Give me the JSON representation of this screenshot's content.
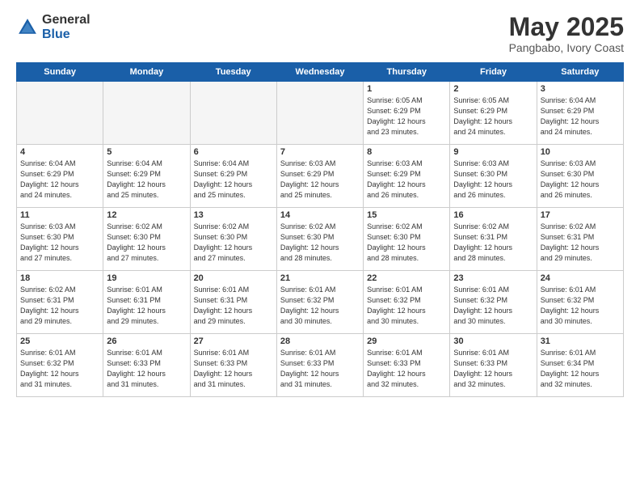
{
  "header": {
    "logo_general": "General",
    "logo_blue": "Blue",
    "title": "May 2025",
    "subtitle": "Pangbabo, Ivory Coast"
  },
  "weekdays": [
    "Sunday",
    "Monday",
    "Tuesday",
    "Wednesday",
    "Thursday",
    "Friday",
    "Saturday"
  ],
  "weeks": [
    [
      {
        "day": "",
        "info": ""
      },
      {
        "day": "",
        "info": ""
      },
      {
        "day": "",
        "info": ""
      },
      {
        "day": "",
        "info": ""
      },
      {
        "day": "1",
        "info": "Sunrise: 6:05 AM\nSunset: 6:29 PM\nDaylight: 12 hours\nand 23 minutes."
      },
      {
        "day": "2",
        "info": "Sunrise: 6:05 AM\nSunset: 6:29 PM\nDaylight: 12 hours\nand 24 minutes."
      },
      {
        "day": "3",
        "info": "Sunrise: 6:04 AM\nSunset: 6:29 PM\nDaylight: 12 hours\nand 24 minutes."
      }
    ],
    [
      {
        "day": "4",
        "info": "Sunrise: 6:04 AM\nSunset: 6:29 PM\nDaylight: 12 hours\nand 24 minutes."
      },
      {
        "day": "5",
        "info": "Sunrise: 6:04 AM\nSunset: 6:29 PM\nDaylight: 12 hours\nand 25 minutes."
      },
      {
        "day": "6",
        "info": "Sunrise: 6:04 AM\nSunset: 6:29 PM\nDaylight: 12 hours\nand 25 minutes."
      },
      {
        "day": "7",
        "info": "Sunrise: 6:03 AM\nSunset: 6:29 PM\nDaylight: 12 hours\nand 25 minutes."
      },
      {
        "day": "8",
        "info": "Sunrise: 6:03 AM\nSunset: 6:29 PM\nDaylight: 12 hours\nand 26 minutes."
      },
      {
        "day": "9",
        "info": "Sunrise: 6:03 AM\nSunset: 6:30 PM\nDaylight: 12 hours\nand 26 minutes."
      },
      {
        "day": "10",
        "info": "Sunrise: 6:03 AM\nSunset: 6:30 PM\nDaylight: 12 hours\nand 26 minutes."
      }
    ],
    [
      {
        "day": "11",
        "info": "Sunrise: 6:03 AM\nSunset: 6:30 PM\nDaylight: 12 hours\nand 27 minutes."
      },
      {
        "day": "12",
        "info": "Sunrise: 6:02 AM\nSunset: 6:30 PM\nDaylight: 12 hours\nand 27 minutes."
      },
      {
        "day": "13",
        "info": "Sunrise: 6:02 AM\nSunset: 6:30 PM\nDaylight: 12 hours\nand 27 minutes."
      },
      {
        "day": "14",
        "info": "Sunrise: 6:02 AM\nSunset: 6:30 PM\nDaylight: 12 hours\nand 28 minutes."
      },
      {
        "day": "15",
        "info": "Sunrise: 6:02 AM\nSunset: 6:30 PM\nDaylight: 12 hours\nand 28 minutes."
      },
      {
        "day": "16",
        "info": "Sunrise: 6:02 AM\nSunset: 6:31 PM\nDaylight: 12 hours\nand 28 minutes."
      },
      {
        "day": "17",
        "info": "Sunrise: 6:02 AM\nSunset: 6:31 PM\nDaylight: 12 hours\nand 29 minutes."
      }
    ],
    [
      {
        "day": "18",
        "info": "Sunrise: 6:02 AM\nSunset: 6:31 PM\nDaylight: 12 hours\nand 29 minutes."
      },
      {
        "day": "19",
        "info": "Sunrise: 6:01 AM\nSunset: 6:31 PM\nDaylight: 12 hours\nand 29 minutes."
      },
      {
        "day": "20",
        "info": "Sunrise: 6:01 AM\nSunset: 6:31 PM\nDaylight: 12 hours\nand 29 minutes."
      },
      {
        "day": "21",
        "info": "Sunrise: 6:01 AM\nSunset: 6:32 PM\nDaylight: 12 hours\nand 30 minutes."
      },
      {
        "day": "22",
        "info": "Sunrise: 6:01 AM\nSunset: 6:32 PM\nDaylight: 12 hours\nand 30 minutes."
      },
      {
        "day": "23",
        "info": "Sunrise: 6:01 AM\nSunset: 6:32 PM\nDaylight: 12 hours\nand 30 minutes."
      },
      {
        "day": "24",
        "info": "Sunrise: 6:01 AM\nSunset: 6:32 PM\nDaylight: 12 hours\nand 30 minutes."
      }
    ],
    [
      {
        "day": "25",
        "info": "Sunrise: 6:01 AM\nSunset: 6:32 PM\nDaylight: 12 hours\nand 31 minutes."
      },
      {
        "day": "26",
        "info": "Sunrise: 6:01 AM\nSunset: 6:33 PM\nDaylight: 12 hours\nand 31 minutes."
      },
      {
        "day": "27",
        "info": "Sunrise: 6:01 AM\nSunset: 6:33 PM\nDaylight: 12 hours\nand 31 minutes."
      },
      {
        "day": "28",
        "info": "Sunrise: 6:01 AM\nSunset: 6:33 PM\nDaylight: 12 hours\nand 31 minutes."
      },
      {
        "day": "29",
        "info": "Sunrise: 6:01 AM\nSunset: 6:33 PM\nDaylight: 12 hours\nand 32 minutes."
      },
      {
        "day": "30",
        "info": "Sunrise: 6:01 AM\nSunset: 6:33 PM\nDaylight: 12 hours\nand 32 minutes."
      },
      {
        "day": "31",
        "info": "Sunrise: 6:01 AM\nSunset: 6:34 PM\nDaylight: 12 hours\nand 32 minutes."
      }
    ]
  ]
}
